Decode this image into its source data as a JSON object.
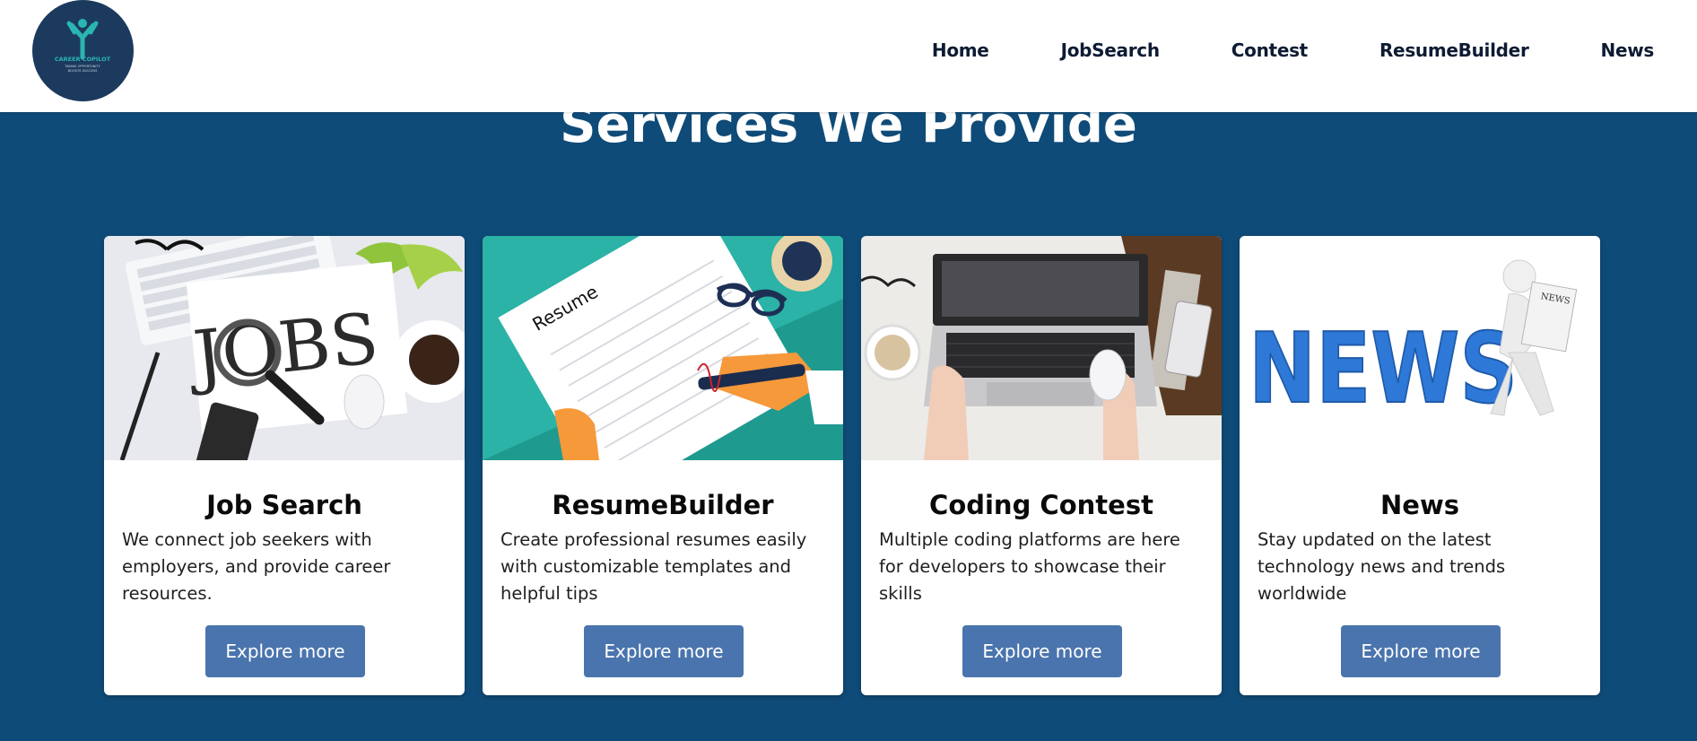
{
  "logo": {
    "line1": "CAREER COPILOT",
    "line2": "TAKING OPPORTUNITY",
    "line3": "BOOSTS SUCCESS"
  },
  "nav": [
    "Home",
    "JobSearch",
    "Contest",
    "ResumeBuilder",
    "News"
  ],
  "section_title": "Services We Provide",
  "cards": [
    {
      "title": "Job Search",
      "description": "We connect job seekers with employers, and provide career resources.",
      "button": "Explore more",
      "image": {
        "word": "JOBS"
      }
    },
    {
      "title": "ResumeBuilder",
      "description": "Create professional resumes easily with customizable templates and helpful tips",
      "button": "Explore more",
      "image": {
        "word": "Resume"
      }
    },
    {
      "title": "Coding Contest",
      "description": "Multiple coding platforms are here for developers to showcase their skills",
      "button": "Explore more",
      "image": {}
    },
    {
      "title": "News",
      "description": "Stay updated on the latest technology news and trends worldwide",
      "button": "Explore more",
      "image": {
        "word": "NEWS",
        "paper_word": "NEWS"
      }
    }
  ],
  "colors": {
    "background": "#0f4b78",
    "button": "#4a74ad",
    "nav_text": "#0d1b33",
    "logo_bg": "#1b3a5e",
    "logo_accent": "#2bb5b0"
  }
}
